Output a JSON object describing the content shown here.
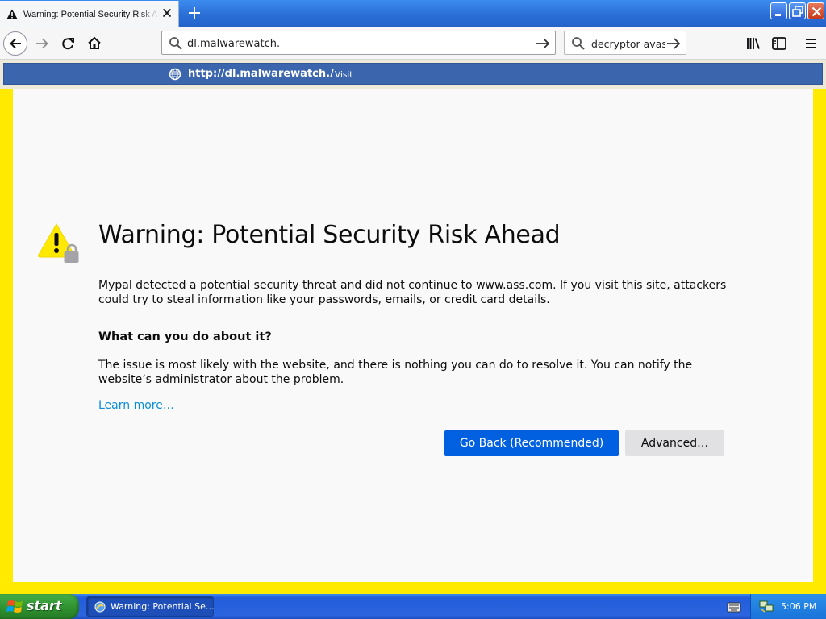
{
  "browser": {
    "tab": {
      "title": "Warning: Potential Security Risk Ahead",
      "icon": "warning-icon"
    },
    "new_tab_icon": "plus-icon",
    "url": "dl.malwarewatch.",
    "search_value": "decryptor avast",
    "suggestion": {
      "url": "http://dl.malwarewatch./",
      "separator": "—",
      "action": "Visit"
    }
  },
  "page": {
    "title": "Warning: Potential Security Risk Ahead",
    "intro": "Mypal detected a potential security threat and did not continue to www.ass.com. If you visit this site, attackers could try to steal information like your passwords, emails, or credit card details.",
    "subheading": "What can you do about it?",
    "explanation": "The issue is most likely with the website, and there is nothing you can do to resolve it. You can notify the website’s administrator about the problem.",
    "learn_more": "Learn more…",
    "go_back": "Go Back (Recommended)",
    "advanced": "Advanced…"
  },
  "taskbar": {
    "start": "start",
    "window_item": "Warning: Potential Se…",
    "clock": "5:06 PM"
  },
  "colors": {
    "page_border": "#ffea00",
    "primary_button": "#0060df",
    "link": "#0a8dd6",
    "suggestion_bg": "#3b66ad"
  }
}
